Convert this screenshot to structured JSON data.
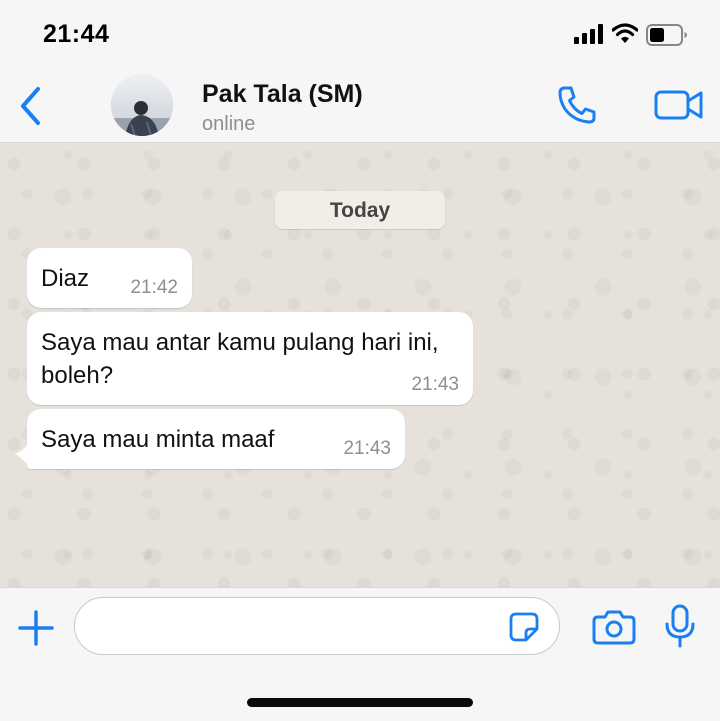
{
  "status_bar": {
    "time": "21:44",
    "icons": [
      "signal-icon",
      "wifi-icon",
      "battery-icon"
    ]
  },
  "header": {
    "back_icon": "chevron-left-icon",
    "contact_name": "Pak Tala (SM)",
    "contact_status": "online",
    "actions": [
      "voice-call-icon",
      "video-call-icon"
    ]
  },
  "chat": {
    "date_label": "Today",
    "messages": [
      {
        "direction": "incoming",
        "text": "Diaz",
        "time": "21:42"
      },
      {
        "direction": "incoming",
        "text": "Saya mau antar kamu pulang hari ini, boleh?",
        "time": "21:43"
      },
      {
        "direction": "incoming",
        "text": "Saya mau minta maaf",
        "time": "21:43"
      }
    ]
  },
  "input_bar": {
    "placeholder": "",
    "value": "",
    "icons": [
      "plus-icon",
      "sticker-icon",
      "camera-icon",
      "microphone-icon"
    ]
  },
  "colors": {
    "accent": "#1a7ff0",
    "chat_background": "#e6e1da",
    "bubble_incoming": "#ffffff",
    "date_chip": "#f0eee6",
    "timestamp": "#8e8e93"
  }
}
